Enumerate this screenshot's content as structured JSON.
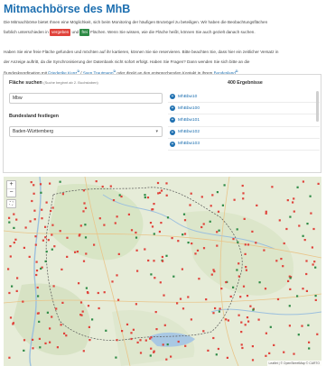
{
  "page": {
    "title": "Mitmachbörse des MhB",
    "para1": {
      "line1": "Die Mitmachbörse bietet Ihnen eine Möglichkeit, sich beim Monitoring der häufigen Brutvögel zu beteiligen. Wir haben die Beobachtungsflächen",
      "line2_a": "farblich unterschieden in",
      "vergeben": "vergeben",
      "und": "und",
      "frei": "frei",
      "line2_b": "Flächen. Wenn Sie wissen, wie die Fläche heißt, können Sie auch gezielt danach suchen."
    },
    "para2": {
      "line1": "Haben Sie eine freie Fläche gefunden und möchten auf ihr kartieren, können Sie sie reservieren. Bitte beachten Sie, dass hier ein zeitlicher Versatz in",
      "line2": "der Anzeige auftritt, da die Synchronisierung der Datenbank nicht sofort erfolgt. Haben Sie Fragen? Dann wenden Sie sich bitte an die",
      "line3_a": "Bundeskoordination mit",
      "link1": "Friederike Kunz",
      "sep": "/",
      "link2": "Sven Trautmann",
      "line3_b": "oder direkt an den entsprechenden Kontakt in Ihrem",
      "link3": "Bundesland",
      "end": "."
    },
    "colors": {
      "accent": "#1d6fb0",
      "vergeben": "#e0433b",
      "frei": "#2e8b46"
    }
  },
  "search": {
    "label": "Fläche suchen",
    "hint": "(Suche beginnt ab 2. Buchstaben)",
    "value": "Mbw"
  },
  "state": {
    "label": "Bundesland festlegen",
    "selected": "Baden-Württemberg"
  },
  "results": {
    "count_label": "400 Ergebnisse",
    "items": [
      "MhBbw10",
      "MhBbw100",
      "MhBbw101",
      "MhBbw102",
      "MhBbw103"
    ]
  },
  "map": {
    "zoom_in": "+",
    "zoom_out": "−",
    "attribution": "Leaflet | © OpenStreetMap © CARTO"
  }
}
